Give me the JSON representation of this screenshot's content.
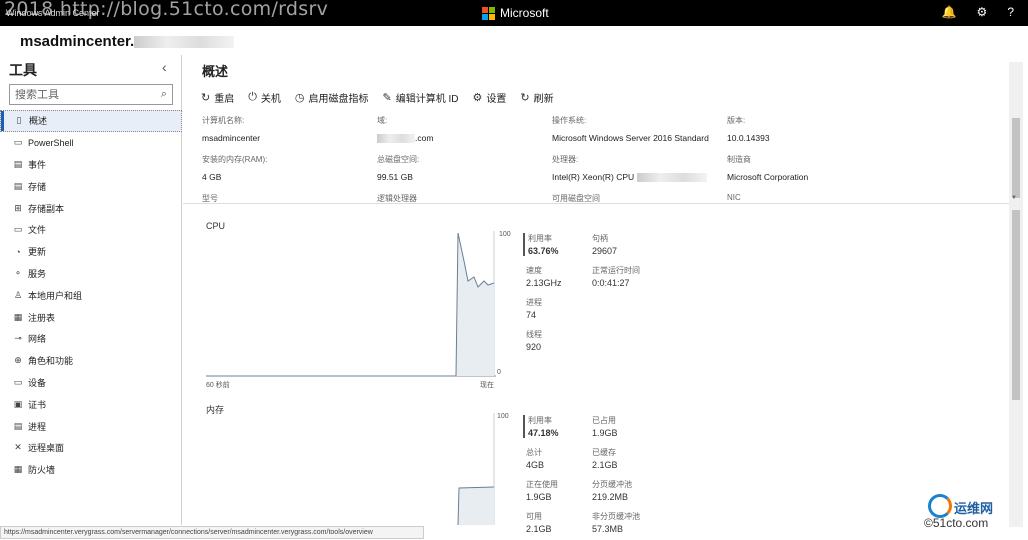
{
  "topbar": {
    "app_title": "Windows Admin Center",
    "watermark": "2018 http://blog.51cto.com/rdsrv",
    "brand": "Microsoft",
    "icons": [
      "bell-icon",
      "gear-icon",
      "help-icon"
    ],
    "icon_glyphs": {
      "bell": "🔔",
      "gear": "⚙",
      "help": "?"
    }
  },
  "server": {
    "name": "msadmincenter."
  },
  "sidebar": {
    "title": "工具",
    "collapse_glyph": "‹",
    "search_placeholder": "搜索工具",
    "items": [
      {
        "label": "概述",
        "icon": "server-icon",
        "glyph": "▯",
        "active": true
      },
      {
        "label": "PowerShell",
        "icon": "powershell-icon",
        "glyph": "▭"
      },
      {
        "label": "事件",
        "icon": "events-icon",
        "glyph": "▤"
      },
      {
        "label": "存储",
        "icon": "storage-icon",
        "glyph": "▤"
      },
      {
        "label": "存储副本",
        "icon": "storage-replica-icon",
        "glyph": "⊞"
      },
      {
        "label": "文件",
        "icon": "files-icon",
        "glyph": "▭"
      },
      {
        "label": "更新",
        "icon": "updates-icon",
        "glyph": "◔"
      },
      {
        "label": "服务",
        "icon": "services-icon",
        "glyph": "⚬"
      },
      {
        "label": "本地用户和组",
        "icon": "users-icon",
        "glyph": "♙"
      },
      {
        "label": "注册表",
        "icon": "registry-icon",
        "glyph": "▦"
      },
      {
        "label": "网络",
        "icon": "network-icon",
        "glyph": "⊸"
      },
      {
        "label": "角色和功能",
        "icon": "roles-icon",
        "glyph": "⊕"
      },
      {
        "label": "设备",
        "icon": "devices-icon",
        "glyph": "▭"
      },
      {
        "label": "证书",
        "icon": "certificates-icon",
        "glyph": "▣"
      },
      {
        "label": "进程",
        "icon": "processes-icon",
        "glyph": "▤"
      },
      {
        "label": "远程桌面",
        "icon": "remote-desktop-icon",
        "glyph": "✕"
      },
      {
        "label": "防火墙",
        "icon": "firewall-icon",
        "glyph": "▦"
      }
    ]
  },
  "main": {
    "title": "概述",
    "toolbar": [
      {
        "label": "重启",
        "icon": "restart-icon",
        "glyph": "↻"
      },
      {
        "label": "关机",
        "icon": "power-icon",
        "glyph": "⏻"
      },
      {
        "label": "启用磁盘指标",
        "icon": "disk-metrics-icon",
        "glyph": "◷"
      },
      {
        "label": "编辑计算机 ID",
        "icon": "edit-icon",
        "glyph": "✎"
      },
      {
        "label": "设置",
        "icon": "settings-icon",
        "glyph": "⚙"
      },
      {
        "label": "刷新",
        "icon": "refresh-icon",
        "glyph": "↻"
      }
    ],
    "properties": {
      "computer_name_label": "计算机名称:",
      "computer_name": "msadmincenter",
      "domain_label": "域:",
      "domain": ".com",
      "os_label": "操作系统:",
      "os": "Microsoft Windows Server 2016 Standard",
      "version_label": "版本:",
      "version": "10.0.14393",
      "ram_label": "安装的内存(RAM):",
      "ram": "4 GB",
      "disk_label": "总磁盘空间:",
      "disk": "99.51 GB",
      "cpu_label": "处理器:",
      "cpu": "Intel(R) Xeon(R) CPU",
      "manufacturer_label": "制造商",
      "manufacturer": "Microsoft Corporation",
      "model_label": "型号",
      "logical_label": "逻辑处理器",
      "free_disk_label": "可用磁盘空间",
      "nic_label": "NIC"
    },
    "cpu": {
      "title": "CPU",
      "y_max": "100",
      "y_min": "0",
      "x_left": "60 秒前",
      "x_right": "现在",
      "usage_label": "利用率",
      "usage": "63.76%",
      "handles_label": "句柄",
      "handles": "29607",
      "speed_label": "速度",
      "speed": "2.13GHz",
      "uptime_label": "正常运行时间",
      "uptime": "0:0:41:27",
      "processes_label": "进程",
      "processes": "74",
      "threads_label": "线程",
      "threads": "920"
    },
    "memory": {
      "title": "内存",
      "y_max": "100",
      "usage_label": "利用率",
      "usage": "47.18%",
      "committed_label": "已占用",
      "committed": "1.9GB",
      "total_label": "总计",
      "total": "4GB",
      "cached_label": "已缓存",
      "cached": "2.1GB",
      "in_use_label": "正在使用",
      "in_use": "1.9GB",
      "paged_label": "分页缓冲池",
      "paged": "219.2MB",
      "available_label": "可用",
      "available": "2.1GB",
      "nonpaged_label": "非分页缓冲池",
      "nonpaged": "57.3MB"
    }
  },
  "statusbar": {
    "url": "https://msadmincenter.verygrass.com/servermanager/connections/server/msadmincenter.verygrass.com/tools/overview"
  },
  "watermark2": {
    "line1": "运维网",
    "line2": "©51cto.com"
  },
  "colors": {
    "topbar_bg": "#000000",
    "active_accent": "#1a5fb4",
    "chart_fill": "#e8edf2",
    "chart_line": "#6a7f95"
  }
}
